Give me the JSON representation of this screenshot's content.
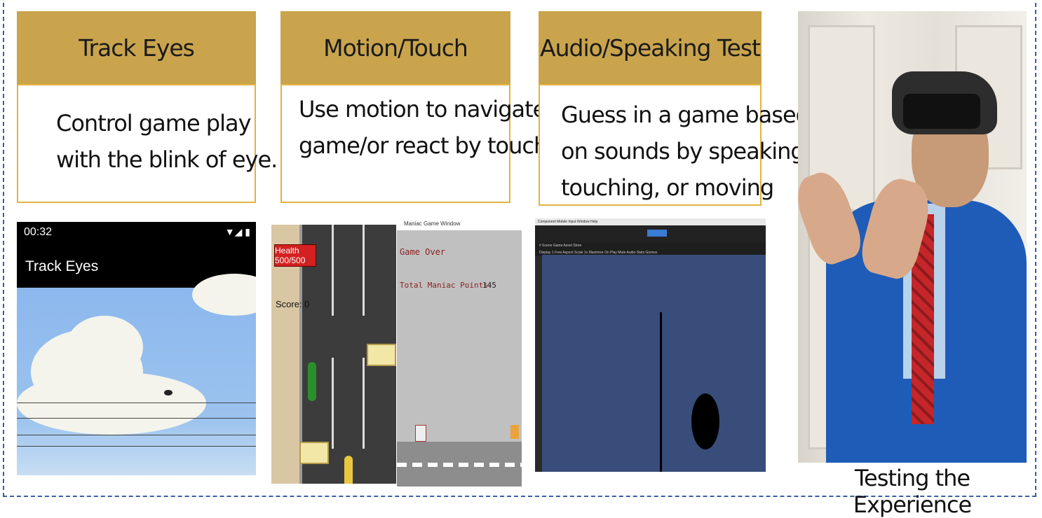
{
  "cards": [
    {
      "header": "Track Eyes",
      "lines": [
        "Control game play",
        "with the blink of eye."
      ]
    },
    {
      "header": "Motion/Touch",
      "lines": [
        "Use motion to navigate in a",
        "game/or react by touch"
      ]
    },
    {
      "header": "Audio/Speaking Test",
      "lines": [
        "Guess in a game based",
        "on sounds by speaking,",
        "touching, or moving"
      ]
    }
  ],
  "phone": {
    "time": "00:32",
    "status_icons": "▼◢ ▮",
    "app_title": "Track Eyes"
  },
  "road_game": {
    "health": "Health 500/500",
    "score": "Score: 0"
  },
  "game_over": {
    "window_title": "Maniac Game Window",
    "line1": "Game Over",
    "line2": "Total Maniac Points:",
    "points": "145"
  },
  "unity": {
    "menubar": "Component  Mobile Input  Window  Help",
    "tabs": "# Scene   Game   Asset Store",
    "subbar": "Display 1   Free Aspect   Scale  1x      Maximize On Play  Mute Audio  Stats  Gizmos"
  },
  "photo_caption": "Testing the Experience"
}
